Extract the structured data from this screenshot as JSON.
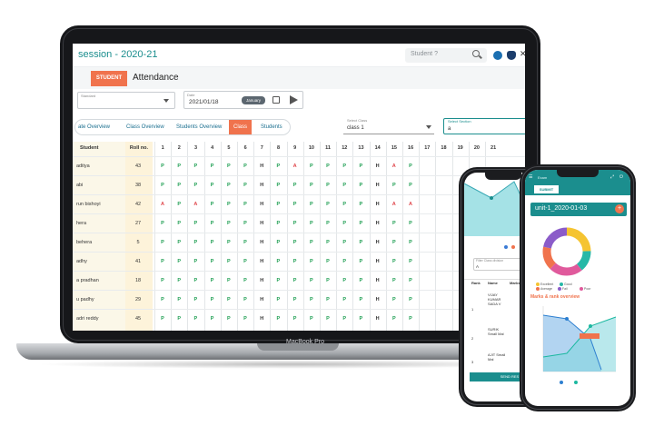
{
  "laptop": {
    "brand": "MacBook Pro",
    "session_title": "session - 2020-21",
    "search_placeholder": "Student ?",
    "student_tab": "STUDENT",
    "page_title": "Attendance",
    "filter1_label": "Standard",
    "date_label": "Date",
    "date_value": "2021/01/18",
    "month_label": "January",
    "view_tabs": [
      "ate Overview",
      "Class Overview",
      "Students Overview",
      "Class",
      "Students"
    ],
    "active_tab_index": 3,
    "select_class_label": "Select Class",
    "select_class_value": "class 1",
    "select_section_label": "Select Section",
    "select_section_value": "a",
    "table_headers": {
      "student": "Student",
      "roll": "Roll no."
    },
    "day_headers": [
      "1",
      "2",
      "3",
      "4",
      "5",
      "6",
      "7",
      "8",
      "9",
      "10",
      "11",
      "12",
      "13",
      "14",
      "15",
      "16",
      "17",
      "18",
      "19",
      "20",
      "21"
    ],
    "rows": [
      {
        "name": "aditya",
        "roll": "43",
        "marks": [
          "P",
          "P",
          "P",
          "P",
          "P",
          "P",
          "H",
          "P",
          "A",
          "P",
          "P",
          "P",
          "P",
          "H",
          "A",
          "P",
          "",
          "",
          "",
          "",
          ""
        ]
      },
      {
        "name": "abi",
        "roll": "38",
        "marks": [
          "P",
          "P",
          "P",
          "P",
          "P",
          "P",
          "H",
          "P",
          "P",
          "P",
          "P",
          "P",
          "P",
          "H",
          "P",
          "P",
          "",
          "",
          "",
          "",
          ""
        ]
      },
      {
        "name": "run bishoyi",
        "roll": "42",
        "marks": [
          "A",
          "P",
          "A",
          "P",
          "P",
          "P",
          "H",
          "P",
          "P",
          "P",
          "P",
          "P",
          "P",
          "H",
          "A",
          "A",
          "",
          "",
          "",
          "",
          ""
        ]
      },
      {
        "name": "hera",
        "roll": "27",
        "marks": [
          "P",
          "P",
          "P",
          "P",
          "P",
          "P",
          "H",
          "P",
          "P",
          "P",
          "P",
          "P",
          "P",
          "H",
          "P",
          "P",
          "",
          "",
          "",
          "",
          ""
        ]
      },
      {
        "name": "behera",
        "roll": "5",
        "marks": [
          "P",
          "P",
          "P",
          "P",
          "P",
          "P",
          "H",
          "P",
          "P",
          "P",
          "P",
          "P",
          "P",
          "H",
          "P",
          "P",
          "",
          "",
          "",
          "",
          ""
        ]
      },
      {
        "name": "adhy",
        "roll": "41",
        "marks": [
          "P",
          "P",
          "P",
          "P",
          "P",
          "P",
          "H",
          "P",
          "P",
          "P",
          "P",
          "P",
          "P",
          "H",
          "P",
          "P",
          "",
          "",
          "",
          "",
          ""
        ]
      },
      {
        "name": "a pradhan",
        "roll": "18",
        "marks": [
          "P",
          "P",
          "P",
          "P",
          "P",
          "P",
          "H",
          "P",
          "P",
          "P",
          "P",
          "P",
          "P",
          "H",
          "P",
          "P",
          "",
          "",
          "",
          "",
          ""
        ]
      },
      {
        "name": "u padhy",
        "roll": "29",
        "marks": [
          "P",
          "P",
          "P",
          "P",
          "P",
          "P",
          "H",
          "P",
          "P",
          "P",
          "P",
          "P",
          "P",
          "H",
          "P",
          "P",
          "",
          "",
          "",
          "",
          ""
        ]
      },
      {
        "name": "adri reddy",
        "roll": "45",
        "marks": [
          "P",
          "P",
          "P",
          "P",
          "P",
          "P",
          "H",
          "P",
          "P",
          "P",
          "P",
          "P",
          "P",
          "H",
          "P",
          "P",
          "",
          "",
          "",
          "",
          ""
        ]
      }
    ]
  },
  "phone1": {
    "filter_label": "Filter Class division",
    "filter_value": "A",
    "table_headers": [
      "Rank",
      "Name",
      "Marks"
    ],
    "rows": [
      {
        "rank": "1",
        "name": "VIJAY KUMAR SADA V"
      },
      {
        "rank": "2",
        "name": "SURIK Small Mal"
      },
      {
        "rank": "3",
        "name": "AJIT Small Mal"
      }
    ],
    "send_button": "SEND RES"
  },
  "phone2": {
    "header_label": "Exam",
    "submit": "SUBMIT",
    "unit_title": "unit-1_2020-01-03",
    "plus": "+",
    "legend": [
      "Excellent",
      "Good",
      "Average",
      "Fail",
      "Poor"
    ],
    "marks_title": "Marks & rank overview"
  },
  "colors": {
    "teal": "#1b8e8e",
    "orange": "#f0734d",
    "present": "#1e9e52",
    "absent": "#e0474c",
    "holiday": "#333333",
    "donut": [
      "#f5c431",
      "#26b8a7",
      "#f0734d",
      "#8b5cc9",
      "#e05a9c"
    ]
  }
}
